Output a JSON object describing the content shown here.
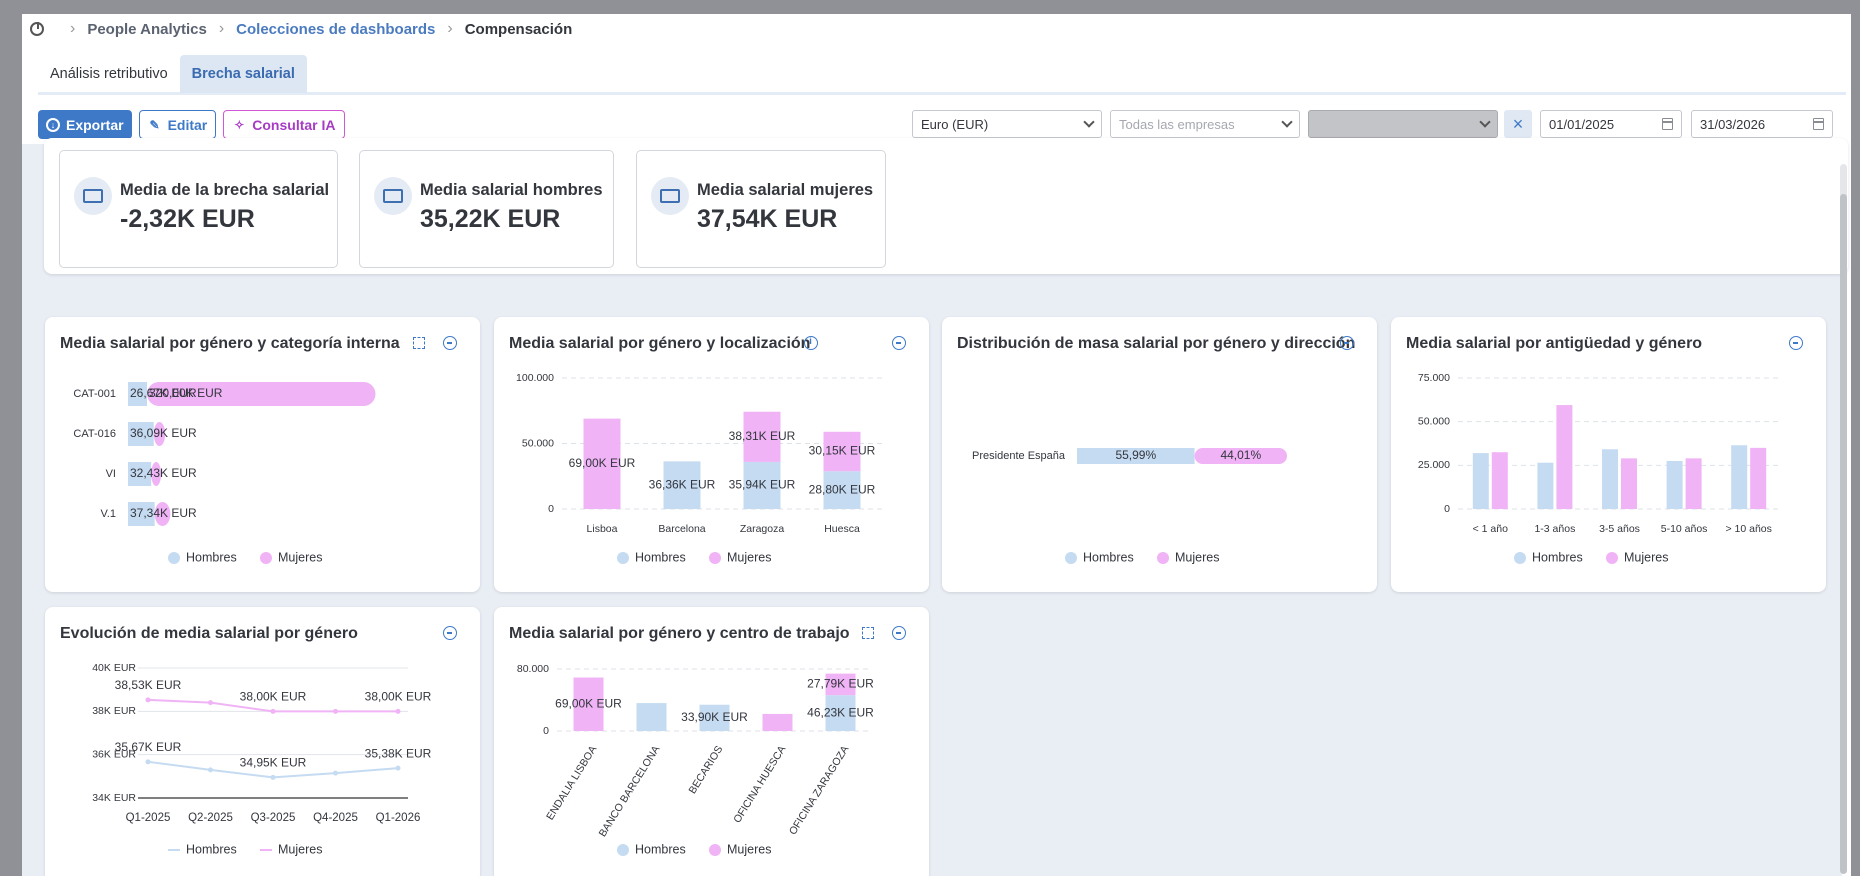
{
  "breadcrumb": {
    "items": [
      "People Analytics",
      "Colecciones de dashboards",
      "Compensación"
    ]
  },
  "tabs": [
    {
      "label": "Análisis retributivo"
    },
    {
      "label": "Brecha salarial"
    }
  ],
  "toolbar": {
    "export": "Exportar",
    "edit": "Editar",
    "ai": "Consultar IA"
  },
  "filters": {
    "currency": "Euro (EUR)",
    "company_placeholder": "Todas las empresas",
    "date_from": "01/01/2025",
    "date_to": "31/03/2026"
  },
  "kpis": [
    {
      "label": "Media de la brecha salarial",
      "value": "-2,32K EUR"
    },
    {
      "label": "Media salarial hombres",
      "value": "35,22K EUR"
    },
    {
      "label": "Media salarial mujeres",
      "value": "37,54K EUR"
    }
  ],
  "legend": {
    "men": "Hombres",
    "women": "Mujeres"
  },
  "colors": {
    "men": "#c5dbf1",
    "women": "#f0b3f5",
    "accent": "#3e79c8"
  },
  "cards": {
    "category": "Media salarial por género y categoría interna",
    "location": "Media salarial por género y localización",
    "direction": "Distribución de masa salarial por género y dirección",
    "seniority": "Media salarial por antigüedad y género",
    "evolution": "Evolución de media salarial por género",
    "workcenter": "Media salarial por género y centro de trabajo"
  },
  "chart_data": [
    {
      "id": "category",
      "type": "bar",
      "orientation": "horizontal",
      "stacked": true,
      "categories": [
        "CAT-001",
        "CAT-016",
        "VI",
        "V.1"
      ],
      "series": [
        {
          "name": "Hombres",
          "values": [
            26.67,
            36.09,
            32.43,
            37.34
          ],
          "labels": [
            "26,67K EUR",
            "36,09K EUR",
            "32,43K EUR",
            "37,34K EUR"
          ]
        },
        {
          "name": "Mujeres",
          "values": [
            320.0,
            16,
            14,
            22
          ],
          "labels": [
            "320,00K EUR",
            "",
            "",
            ""
          ]
        }
      ]
    },
    {
      "id": "location",
      "type": "bar",
      "stacked": true,
      "ylim": [
        0,
        100000
      ],
      "yticks": [
        {
          "v": 100000,
          "label": "100.000"
        },
        {
          "v": 50000,
          "label": "50.000"
        },
        {
          "v": 0,
          "label": "0"
        }
      ],
      "categories": [
        "Lisboa",
        "Barcelona",
        "Zaragoza",
        "Huesca"
      ],
      "series": [
        {
          "name": "Hombres",
          "values": [
            0,
            36360,
            35940,
            28800
          ],
          "labels": [
            "",
            "36,36K EUR",
            "35,94K EUR",
            "28,80K EUR"
          ]
        },
        {
          "name": "Mujeres",
          "values": [
            69000,
            0,
            38310,
            30150
          ],
          "labels": [
            "69,00K EUR",
            "",
            "38,31K EUR",
            "30,15K EUR"
          ]
        }
      ]
    },
    {
      "id": "direction",
      "type": "bar",
      "orientation": "horizontal",
      "percent": true,
      "categories": [
        "Presidente España"
      ],
      "series": [
        {
          "name": "Hombres",
          "values": [
            55.99
          ],
          "labels": [
            "55,99%"
          ]
        },
        {
          "name": "Mujeres",
          "values": [
            44.01
          ],
          "labels": [
            "44,01%"
          ]
        }
      ]
    },
    {
      "id": "seniority",
      "type": "bar",
      "ylim": [
        0,
        75000
      ],
      "yticks": [
        {
          "v": 75000,
          "label": "75.000"
        },
        {
          "v": 50000,
          "label": "50.000"
        },
        {
          "v": 25000,
          "label": "25.000"
        },
        {
          "v": 0,
          "label": "0"
        }
      ],
      "categories": [
        "< 1 año",
        "1-3 años",
        "3-5 años",
        "5-10 años",
        "> 10 años"
      ],
      "series": [
        {
          "name": "Hombres",
          "values": [
            32000,
            26500,
            34200,
            27500,
            36500
          ]
        },
        {
          "name": "Mujeres",
          "values": [
            32500,
            59500,
            29000,
            29000,
            35000
          ]
        }
      ]
    },
    {
      "id": "evolution",
      "type": "line",
      "ylim": [
        34000,
        40000
      ],
      "yticks": [
        {
          "v": 40000,
          "label": "40K EUR"
        },
        {
          "v": 38000,
          "label": "38K EUR"
        },
        {
          "v": 36000,
          "label": "36K EUR"
        },
        {
          "v": 34000,
          "label": "34K EUR"
        }
      ],
      "categories": [
        "Q1-2025",
        "Q2-2025",
        "Q3-2025",
        "Q4-2025",
        "Q1-2026"
      ],
      "series": [
        {
          "name": "Hombres",
          "values": [
            35670,
            35300,
            34950,
            35150,
            35380
          ],
          "labels": [
            "35,67K EUR",
            "",
            "34,95K EUR",
            "",
            "35,38K EUR"
          ]
        },
        {
          "name": "Mujeres",
          "values": [
            38530,
            38400,
            38000,
            38000,
            38000
          ],
          "labels": [
            "38,53K EUR",
            "",
            "38,00K EUR",
            "",
            "38,00K EUR"
          ]
        }
      ]
    },
    {
      "id": "workcenter",
      "type": "bar",
      "stacked": true,
      "ylim": [
        0,
        80000
      ],
      "yticks": [
        {
          "v": 80000,
          "label": "80.000"
        },
        {
          "v": 0,
          "label": "0"
        }
      ],
      "categories": [
        "ENDALIA LISBOA",
        "BANCO BARCELONA",
        "BECARIOS",
        "OFICINA HUESCA",
        "OFICINA ZARAGOZA"
      ],
      "series": [
        {
          "name": "Hombres",
          "values": [
            0,
            36000,
            33900,
            0,
            46230
          ],
          "labels": [
            "",
            "",
            "33,90K EUR",
            "",
            "46,23K EUR"
          ]
        },
        {
          "name": "Mujeres",
          "values": [
            69000,
            0,
            0,
            22000,
            27790
          ],
          "labels": [
            "69,00K EUR",
            "",
            "",
            "",
            "27,79K EUR"
          ]
        }
      ]
    }
  ]
}
